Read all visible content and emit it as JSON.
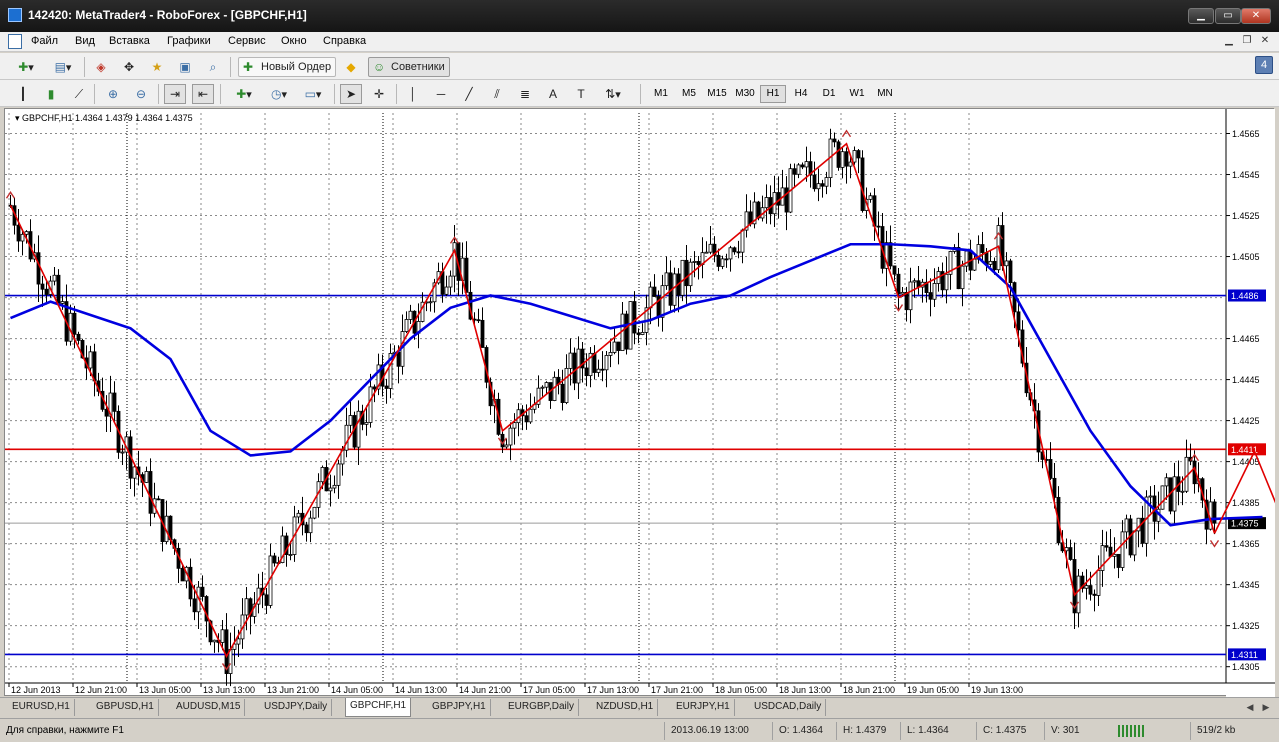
{
  "window": {
    "title": "142420: MetaTrader4 - RoboForex - [GBPCHF,H1]"
  },
  "menu": [
    "Файл",
    "Вид",
    "Вставка",
    "Графики",
    "Сервис",
    "Окно",
    "Справка"
  ],
  "toolbar": {
    "new_order": "Новый Ордер",
    "experts": "Советники"
  },
  "timeframes": [
    "M1",
    "M5",
    "M15",
    "M30",
    "H1",
    "H4",
    "D1",
    "W1",
    "MN"
  ],
  "active_timeframe": "H1",
  "notification_count": "4",
  "chart": {
    "header": "GBPCHF,H1  1.4364 1.4379 1.4364 1.4375",
    "price_ticks": [
      "1.4565",
      "1.4545",
      "1.4525",
      "1.4505",
      "1.4486",
      "1.4465",
      "1.4445",
      "1.4425",
      "1.4411",
      "1.4405",
      "1.4385",
      "1.4375",
      "1.4365",
      "1.4345",
      "1.4325",
      "1.4311",
      "1.4305"
    ],
    "time_ticks": [
      "12 Jun 2013",
      "12 Jun 21:00",
      "13 Jun 05:00",
      "13 Jun 13:00",
      "13 Jun 21:00",
      "14 Jun 05:00",
      "14 Jun 13:00",
      "14 Jun 21:00",
      "17 Jun 05:00",
      "17 Jun 13:00",
      "17 Jun 21:00",
      "18 Jun 05:00",
      "18 Jun 13:00",
      "18 Jun 21:00",
      "19 Jun 05:00",
      "19 Jun 13:00"
    ],
    "levels": {
      "blue_upper": "1.4486",
      "red": "1.4411",
      "current": "1.4375",
      "blue_lower": "1.4311"
    },
    "colors": {
      "candle": "#000000",
      "ma": "#0000e0",
      "zigzag": "#e00000",
      "level_red": "#e00000",
      "level_blue": "#0000cc"
    }
  },
  "chart_data": {
    "type": "candlestick",
    "symbol": "GBPCHF",
    "timeframe": "H1",
    "ylim": [
      1.4299,
      1.4575
    ],
    "zigzag": [
      [
        0,
        1.453
      ],
      [
        54,
        1.431
      ],
      [
        111,
        1.4508
      ],
      [
        123,
        1.442
      ],
      [
        209,
        1.456
      ],
      [
        222,
        1.4485
      ],
      [
        247,
        1.451
      ],
      [
        266,
        1.434
      ],
      [
        296,
        1.4402
      ],
      [
        301,
        1.437
      ]
    ],
    "projection": [
      [
        301,
        1.437
      ],
      [
        311,
        1.441
      ],
      [
        331,
        1.4315
      ]
    ],
    "ma_path": [
      [
        0,
        1.4475
      ],
      [
        10,
        1.4483
      ],
      [
        30,
        1.447
      ],
      [
        40,
        1.4455
      ],
      [
        50,
        1.442
      ],
      [
        60,
        1.4408
      ],
      [
        70,
        1.441
      ],
      [
        80,
        1.4425
      ],
      [
        90,
        1.4445
      ],
      [
        100,
        1.4465
      ],
      [
        110,
        1.448
      ],
      [
        120,
        1.4486
      ],
      [
        130,
        1.4482
      ],
      [
        140,
        1.4476
      ],
      [
        150,
        1.447
      ],
      [
        160,
        1.4474
      ],
      [
        170,
        1.4482
      ],
      [
        180,
        1.4486
      ],
      [
        190,
        1.4495
      ],
      [
        200,
        1.4503
      ],
      [
        210,
        1.4511
      ],
      [
        220,
        1.4511
      ],
      [
        230,
        1.451
      ],
      [
        240,
        1.4508
      ],
      [
        250,
        1.449
      ],
      [
        260,
        1.4455
      ],
      [
        270,
        1.442
      ],
      [
        280,
        1.4393
      ],
      [
        290,
        1.4374
      ],
      [
        300,
        1.4377
      ],
      [
        313,
        1.4378
      ]
    ],
    "last_price": 1.4375
  },
  "tabs": [
    "EURUSD,H1",
    "GBPUSD,H1",
    "AUDUSD,M15",
    "USDJPY,Daily",
    "GBPCHF,H1",
    "GBPJPY,H1",
    "EURGBP,Daily",
    "NZDUSD,H1",
    "EURJPY,H1",
    "USDCAD,Daily"
  ],
  "active_tab": "GBPCHF,H1",
  "status": {
    "help": "Для справки, нажмите F1",
    "time": "2013.06.19 13:00",
    "open": "O: 1.4364",
    "high": "H: 1.4379",
    "low": "L: 1.4364",
    "close": "C: 1.4375",
    "volume": "V: 301",
    "traffic": "519/2 kb"
  }
}
